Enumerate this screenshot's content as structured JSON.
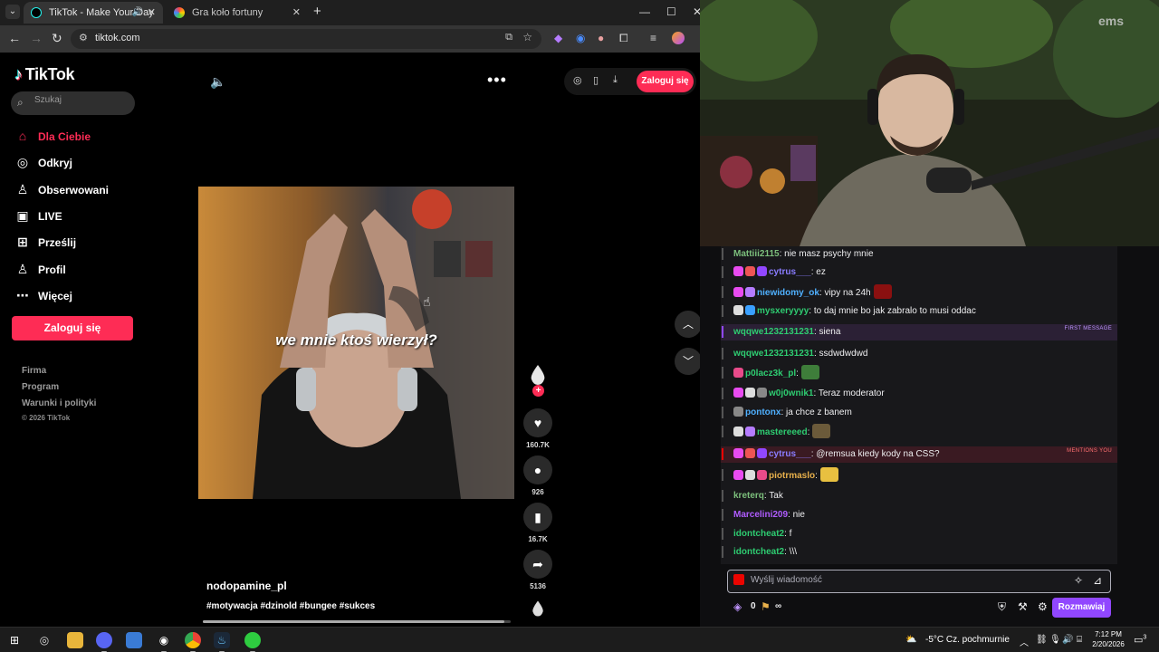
{
  "browser": {
    "tabs": [
      {
        "title": "TikTok - Make Your Day",
        "active": true
      },
      {
        "title": "Gra koło fortuny",
        "active": false
      }
    ],
    "url": "tiktok.com"
  },
  "tiktok": {
    "logo": "TikTok",
    "search_placeholder": "Szukaj",
    "nav": [
      {
        "label": "Dla Ciebie",
        "icon": "home-icon",
        "active": true
      },
      {
        "label": "Odkryj",
        "icon": "compass-icon"
      },
      {
        "label": "Obserwowani",
        "icon": "following-icon"
      },
      {
        "label": "LIVE",
        "icon": "live-icon"
      },
      {
        "label": "Prześlij",
        "icon": "upload-icon"
      },
      {
        "label": "Profil",
        "icon": "profile-icon"
      },
      {
        "label": "Więcej",
        "icon": "more-icon"
      }
    ],
    "login_button": "Zaloguj się",
    "footer": [
      "Firma",
      "Program",
      "Warunki i polityki"
    ],
    "copyright": "© 2026 TikTok",
    "top_login": "Zaloguj się",
    "video": {
      "caption": "we mnie ktoś wierzył?",
      "author": "nodopamine_pl",
      "hashtags": "#motywacja #dzinold #bungee #sukces",
      "progress": 0.98
    },
    "actions": {
      "likes": "160.7K",
      "comments": "926",
      "saves": "16.7K",
      "shares": "5136"
    }
  },
  "chat": {
    "messages": [
      {
        "user": "Mattiii2115",
        "color": "#7cbf7c",
        "text": ": nie masz psychy mnie",
        "badges": []
      },
      {
        "user": "cytrus___",
        "color": "#8a7cff",
        "text": ":  ez",
        "badges": [
          "#e84bf0",
          "#e55",
          "#9147ff"
        ]
      },
      {
        "user": "niewidomy_ok",
        "color": "#4fb0ff",
        "text": ": vipy na 24h",
        "badges": [
          "#e84bf0",
          "#b57cff"
        ],
        "emote": "#8a1010"
      },
      {
        "user": "mysxeryyyy",
        "color": "#2ecc71",
        "text": ": to daj mnie bo jak zabralo to musi oddac",
        "badges": [
          "#ddd",
          "#3aa0ff"
        ]
      },
      {
        "user": "wqqwe1232131231",
        "color": "#2ecc71",
        "text": ": siena",
        "badges": [],
        "tag": "FIRST MESSAGE",
        "type": "first"
      },
      {
        "user": "wqqwe1232131231",
        "color": "#2ecc71",
        "text": ": ssdwdwdwd",
        "badges": []
      },
      {
        "user": "p0lacz3k_pl",
        "color": "#2ecc71",
        "text": ":",
        "badges": [
          "#e84b8a"
        ],
        "emote": "#3e7d3a"
      },
      {
        "user": "w0j0wnik1",
        "color": "#2ecc71",
        "text": ": Teraz moderator",
        "badges": [
          "#e84bf0",
          "#ddd",
          "#888"
        ]
      },
      {
        "user": "pontonx",
        "color": "#4fb0ff",
        "text": ": ja chce z banem",
        "badges": [
          "#888"
        ]
      },
      {
        "user": "mastereeed",
        "color": "#2ecc71",
        "text": ":",
        "badges": [
          "#ddd",
          "#b57cff"
        ],
        "emote": "#6b5a3a"
      },
      {
        "user": "cytrus___",
        "color": "#8a7cff",
        "text": ": @remsua kiedy kody na CSS?",
        "badges": [
          "#e84bf0",
          "#e55",
          "#9147ff"
        ],
        "tag": "MENTIONS YOU",
        "type": "mention"
      },
      {
        "user": "piotrmaslo",
        "color": "#e8b04b",
        "text": ":",
        "badges": [
          "#e84bf0",
          "#ddd",
          "#e84b8a"
        ],
        "emote": "#e8c040"
      },
      {
        "user": "kreterq",
        "color": "#7cbf7c",
        "text": ": Tak",
        "badges": []
      },
      {
        "user": "Marcelini209",
        "color": "#b05cff",
        "text": ": nie",
        "badges": []
      },
      {
        "user": "idontcheat2",
        "color": "#2ecc71",
        "text": ": f",
        "badges": []
      },
      {
        "user": "idontcheat2",
        "color": "#2ecc71",
        "text": ": \\\\\\",
        "badges": []
      }
    ],
    "input_placeholder": "Wyślij wiadomość",
    "points": "0",
    "infinity": "∞",
    "chat_button": "Rozmawiaj"
  },
  "taskbar": {
    "weather": "-5°C  Cz. pochmurnie",
    "time": "7:12 PM",
    "date": "2/20/2026",
    "notifications": "3"
  }
}
